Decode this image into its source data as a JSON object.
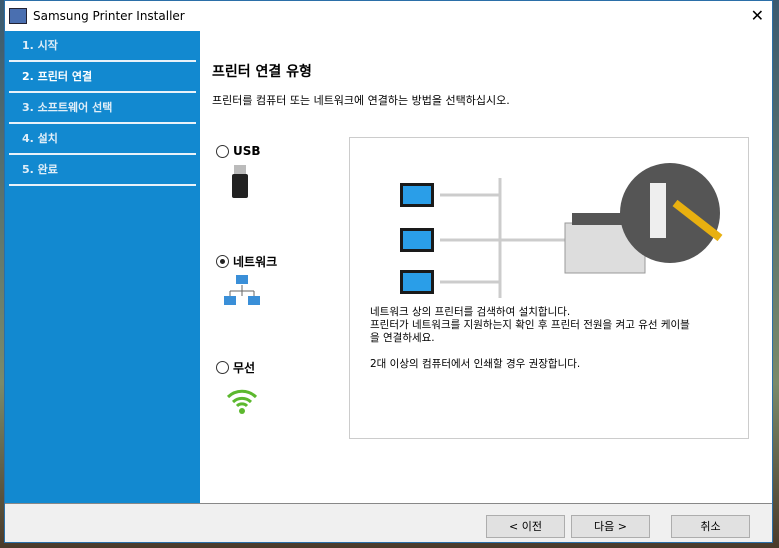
{
  "window": {
    "title": "Samsung Printer Installer"
  },
  "steps": [
    "1. 시작",
    "2. 프린터 연결",
    "3. 소프트웨어 선택",
    "4. 설치",
    "5. 완료"
  ],
  "main": {
    "title": "프린터 연결 유형",
    "description": "프린터를 컴퓨터 또는 네트워크에 연결하는 방법을 선택하십시오.",
    "options": [
      {
        "label": "USB",
        "selected": false
      },
      {
        "label": "네트워크",
        "selected": true
      },
      {
        "label": "무선",
        "selected": false
      }
    ],
    "panel_lines": [
      "네트워크 상의 프린터를 검색하여 설치합니다.",
      "프린터가 네트워크를 지원하는지 확인 후 프린터 전원을 켜고 유선 케이블",
      "을 연결하세요.",
      "2대 이상의 컴퓨터에서 인쇄할 경우 권장합니다."
    ]
  },
  "buttons": {
    "back": "< 이전",
    "next": "다음 >",
    "cancel": "취소"
  }
}
